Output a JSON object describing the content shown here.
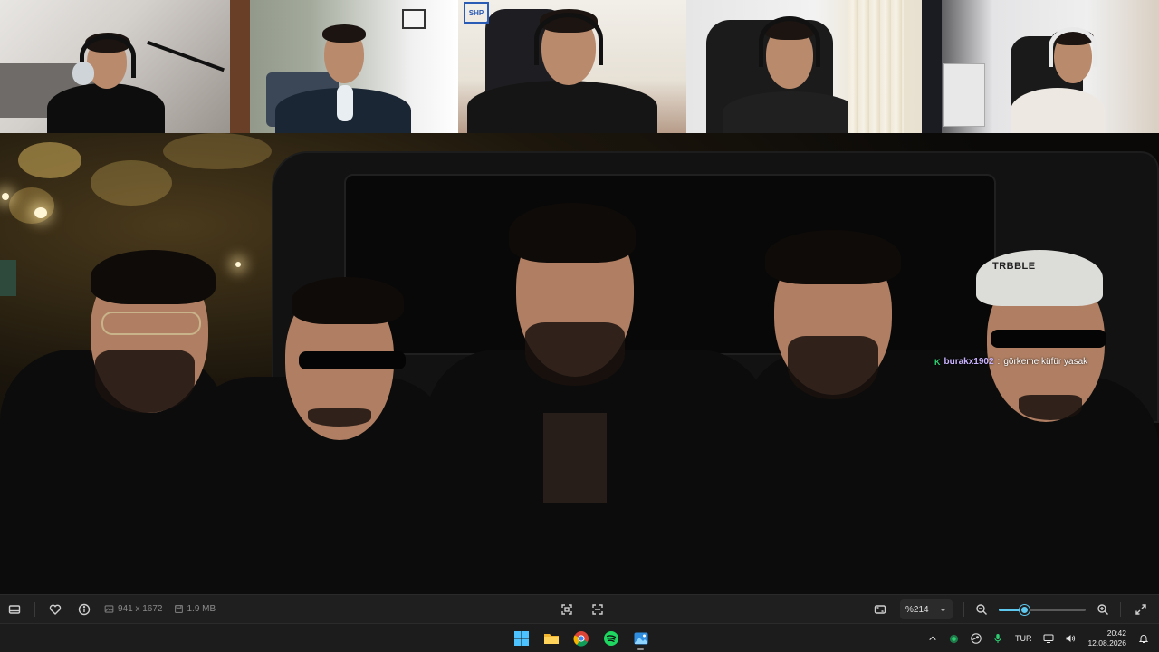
{
  "webcams": [
    {
      "name": "cam-1"
    },
    {
      "name": "cam-2"
    },
    {
      "name": "cam-3"
    },
    {
      "name": "cam-4"
    },
    {
      "name": "cam-5"
    }
  ],
  "photo": {
    "cap_text": "TRBBLE"
  },
  "chat": {
    "badge": "K",
    "username": "burakx1902",
    "separator": ":",
    "message": "görkeme küfür yasak"
  },
  "viewer_toolbar": {
    "dimensions": "941 x 1672",
    "file_size": "1.9 MB",
    "zoom": "%214",
    "zoom_slider_fraction": 0.3,
    "icons": {
      "left": [
        "filmstrip-icon",
        "heart-icon",
        "info-icon"
      ],
      "center": [
        "fit-screen-icon",
        "scan-icon"
      ],
      "right": [
        "aspect-icon",
        "zoom-out-icon",
        "zoom-in-icon",
        "fullscreen-icon"
      ]
    },
    "accent": "#5fc8ef"
  },
  "taskbar": {
    "apps": [
      "windows-start-icon",
      "file-explorer-icon",
      "chrome-icon",
      "spotify-icon",
      "photos-icon"
    ],
    "tray": {
      "language": "TUR",
      "time": "20:42",
      "date": "12.08.2026"
    }
  }
}
